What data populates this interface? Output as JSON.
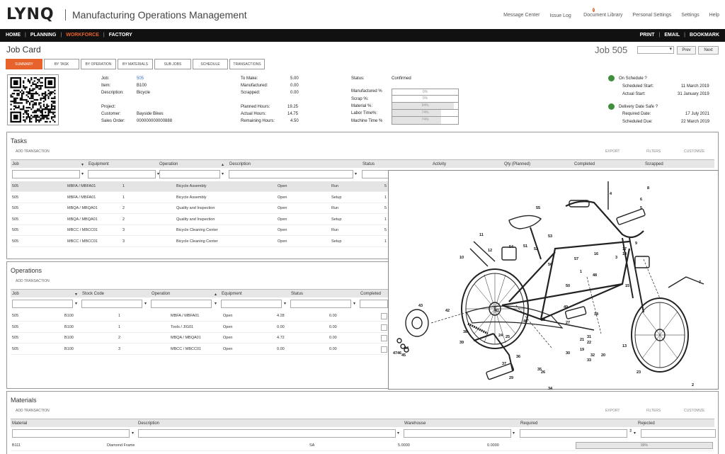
{
  "header": {
    "logo": "LYNQ",
    "title": "Manufacturing Operations Management",
    "links": [
      "Message Center",
      "Issue Log",
      "Document Library",
      "Personal Settings",
      "Settings",
      "Help"
    ],
    "issue_badge": "7"
  },
  "nav": {
    "left": [
      "HOME",
      "PLANNING",
      "WORKFORCE",
      "FACTORY"
    ],
    "active": "WORKFORCE",
    "right": [
      "PRINT",
      "EMAIL",
      "BOOKMARK"
    ]
  },
  "page": {
    "title": "Job Card",
    "job_label": "Job 505",
    "prev": "Prev",
    "next": "Next"
  },
  "tabs": [
    "SUMMARY",
    "BY TASK",
    "BY OPERATION",
    "BY MATERIALS",
    "SUB JOBS",
    "SCHEDULE",
    "TRANSACTIONS"
  ],
  "summary": {
    "job_label": "Job:",
    "job_value": "505",
    "item_label": "Item:",
    "item_value": "B100",
    "desc_label": "Description:",
    "desc_value": "Bicycle",
    "project_label": "Project:",
    "project_value": "",
    "customer_label": "Customer:",
    "customer_value": "Bayside Bikes",
    "sales_label": "Sales Order:",
    "sales_value": "000000000000888",
    "tomake_label": "To Make:",
    "tomake_value": "5.00",
    "manuf_label": "Manufactured:",
    "manuf_value": "0.00",
    "scrap_label": "Scrapped:",
    "scrap_value": "0.00",
    "planned_label": "Planned Hours:",
    "planned_value": "19.25",
    "actual_label": "Actual Hours:",
    "actual_value": "14.75",
    "remain_label": "Remaining Hours:",
    "remain_value": "4.50",
    "status_label": "Status:",
    "status_value": "Confirmed",
    "pcts": [
      {
        "label": "Manufactured %",
        "text": "0%",
        "fill": 0
      },
      {
        "label": "Scrap %:",
        "text": "0%",
        "fill": 0
      },
      {
        "label": "Material %:",
        "text": "94%",
        "fill": 0.94
      },
      {
        "label": "Labor Time%:",
        "text": "74%",
        "fill": 0.74
      },
      {
        "label": "Machine Time %",
        "text": "74%",
        "fill": 0.74
      }
    ],
    "on_schedule": "On Schedule ?",
    "sched_start_label": "Scheduled Start:",
    "sched_start_value": "11 March 2019",
    "actual_start_label": "Actual Start:",
    "actual_start_value": "31 January 2019",
    "delivery_safe": "Delivery Date Safe ?",
    "required_date_label": "Required Date:",
    "required_date_value": "17 July 2021",
    "sched_due_label": "Scheduled Due:",
    "sched_due_value": "22 March 2019",
    "status_color": "#3f8f3c"
  },
  "tasks": {
    "title": "Tasks",
    "add": "ADD TRANSACTION",
    "tools": [
      "EXPORT",
      "FILTERS",
      "CUSTOMIZE"
    ],
    "headers": [
      "Job",
      "Equipment",
      "Operation",
      "Description",
      "Status",
      "Activity",
      "Qty (Planned)",
      "Completed",
      "Scrapped"
    ],
    "rows": [
      [
        "505",
        "MBFA / MBFA01",
        "1",
        "Bicycle Assembly",
        "Open",
        "Run",
        "5"
      ],
      [
        "505",
        "MBFA / MBFA01",
        "1",
        "Bicycle Assembly",
        "Open",
        "Setup",
        "1"
      ],
      [
        "505",
        "MBQA / MBQA01",
        "2",
        "Quality and Inspection",
        "Open",
        "Run",
        "5"
      ],
      [
        "505",
        "MBQA / MBQA01",
        "2",
        "Quality and Inspection",
        "Open",
        "Setup",
        "1"
      ],
      [
        "505",
        "MBCC / MBCC01",
        "3",
        "Bicycle Cleaning Center",
        "Open",
        "Run",
        "5"
      ],
      [
        "505",
        "MBCC / MBCC01",
        "3",
        "Bicycle Cleaning Center",
        "Open",
        "Setup",
        "1"
      ]
    ]
  },
  "operations": {
    "title": "Operations",
    "add": "ADD TRANSACTION",
    "headers": [
      "Job",
      "Stock Code",
      "Operation",
      "Equipment",
      "Status",
      "Completed"
    ],
    "rows": [
      [
        "505",
        "B100",
        "1",
        "MBFA / MBFA01",
        "Open",
        "4.28",
        "0.00"
      ],
      [
        "505",
        "B100",
        "1",
        "Tools / JIG01",
        "Open",
        "0.00",
        "0.00"
      ],
      [
        "505",
        "B100",
        "2",
        "MBQA / MBQA01",
        "Open",
        "4.72",
        "0.00"
      ],
      [
        "505",
        "B100",
        "3",
        "MBCC / MBCC01",
        "Open",
        "0.00",
        "0.00"
      ]
    ]
  },
  "materials": {
    "title": "Materials",
    "add": "ADD TRANSACTION",
    "tools": [
      "EXPORT",
      "FILTERS",
      "CUSTOMIZE"
    ],
    "headers": [
      "Material",
      "Description",
      "Warehouse",
      "Required",
      "Rejected"
    ],
    "rows": [
      [
        "B111",
        "Diamond Frame",
        "SA",
        "5.0000",
        "0.0000",
        "99%"
      ]
    ]
  },
  "diagram": {
    "labels": [
      "1",
      "2",
      "3",
      "4",
      "5",
      "6",
      "7",
      "8",
      "9",
      "10",
      "11",
      "12",
      "13",
      "14",
      "15",
      "16",
      "17",
      "18",
      "19",
      "20",
      "21",
      "22",
      "23",
      "24",
      "25",
      "26",
      "27",
      "28",
      "29",
      "30",
      "31",
      "32",
      "33",
      "34",
      "35",
      "36",
      "37",
      "38",
      "39",
      "40",
      "41",
      "42",
      "43",
      "44",
      "45",
      "46",
      "47",
      "48",
      "49",
      "50",
      "51",
      "52",
      "53",
      "54",
      "55",
      "56",
      "57"
    ]
  }
}
